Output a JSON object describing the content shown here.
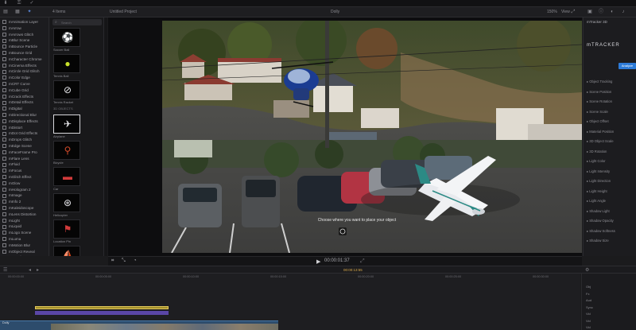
{
  "toolbar": {
    "import_icon": "import-icon",
    "key_icon": "key-icon",
    "check_icon": "check-icon"
  },
  "header": {
    "library_label": "4 Items",
    "effects_label": "Effects",
    "project_title": "Untitled Project",
    "viewer_name": "Dolly",
    "zoom": "150%",
    "view_menu": "View",
    "inspector_title": "mTracker 3D"
  },
  "browser": {
    "items": [
      "mAnimation Layer",
      "mArrow",
      "mArrows Glitch",
      "mBlur Scene",
      "mBounce Particle",
      "mBounce Grid",
      "mCharacter Chrome",
      "mCinema Effects",
      "mCircle Grid Glitch",
      "mColor Edge",
      "mCRT Curve",
      "mCube Grid",
      "mCrack Effects",
      "mDetail Effects",
      "mDigital",
      "mDirectional Blur",
      "mDisplace Effects",
      "mDistort",
      "mDot Grid Effects",
      "mDrops Glitch",
      "mEdge Scene",
      "mFaceFrame Pro",
      "mFlare Lens",
      "mFluid",
      "mFocus",
      "mGlitch Effect",
      "mGlow",
      "mHologram 2",
      "mImage",
      "mInfo 2",
      "mKaleidoscope",
      "mLens Distortion",
      "mLight",
      "mLiquid",
      "mLogo Scene",
      "mLuma",
      "mMotion Blur",
      "mObject Reveal",
      "mPanels",
      "mParticles",
      "mTracker 3D",
      "mTracker 3D Ana",
      "mTracker 3D Cam"
    ],
    "selected_index": 40
  },
  "effects": {
    "search_placeholder": "Search",
    "section_title": "3D OBJECTS",
    "items": [
      {
        "label": "Soccer Ball",
        "icon": "soccer-ball-icon"
      },
      {
        "label": "Tennis Ball",
        "icon": "tennis-ball-icon"
      },
      {
        "label": "Tennis Racket",
        "icon": "tennis-racket-icon"
      },
      {
        "label": "Airplane",
        "icon": "airplane-icon"
      },
      {
        "label": "Bicycle",
        "icon": "bicycle-icon"
      },
      {
        "label": "Car",
        "icon": "car-icon"
      },
      {
        "label": "Helicopter",
        "icon": "helicopter-icon"
      },
      {
        "label": "Location Pin",
        "icon": "location-pin-icon"
      },
      {
        "label": "Sailboat",
        "icon": "sailboat-icon"
      }
    ]
  },
  "viewer": {
    "overlay_text": "Choose where you want to place your object",
    "timecode": "00:00:01:37",
    "accent": "#9a4bd6"
  },
  "inspector": {
    "brand": "mTRACKER",
    "analyze_button": "Analyze",
    "rows": [
      "Object Tracking",
      "Scene Position",
      "Scene Rotation",
      "Scene Scale",
      "Object Offset",
      "Material Position",
      "3D Object Scale",
      "3D Rotation",
      "Light Color",
      "Light Intensity",
      "Light Direction",
      "Light Height",
      "Light Angle",
      "Shadow Light",
      "Shadow Opacity",
      "Shadow Softness",
      "Shadow Size"
    ]
  },
  "timeline": {
    "ruler": [
      "00:00:00:00",
      "00:00:05:00",
      "00:00:10:00",
      "00:00:15:00",
      "00:00:20:00",
      "00:00:25:00",
      "00:00:30:00"
    ],
    "playhead_label": "00:00:13:55",
    "clip_label": "Dolly",
    "effects_labels": [
      "Obj",
      "Fx",
      "Aud",
      "Sync",
      "Vid",
      "Vid",
      "Vid"
    ]
  }
}
